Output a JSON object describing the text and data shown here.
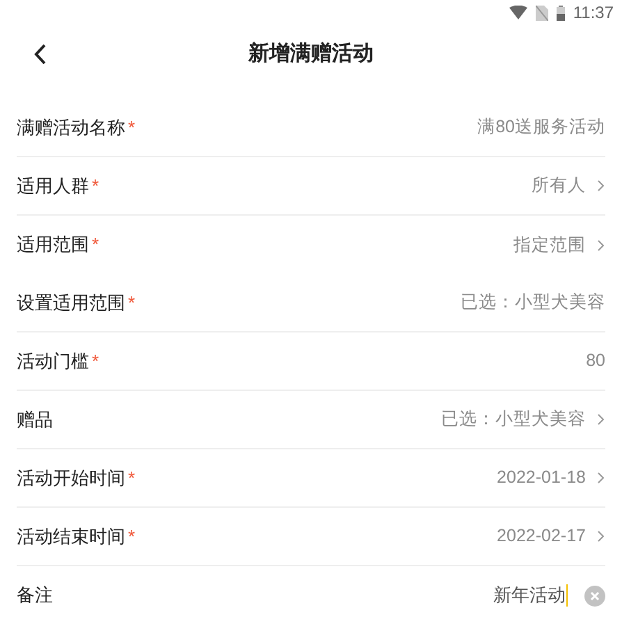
{
  "status_bar": {
    "time": "11:37"
  },
  "header": {
    "title": "新增满赠活动"
  },
  "rows": [
    {
      "kind": "text",
      "label": "满赠活动名称",
      "required_mark": "*",
      "value": "满80送服务活动",
      "divider": true
    },
    {
      "kind": "select",
      "label": "适用人群",
      "required_mark": "*",
      "value": "所有人",
      "divider": true
    },
    {
      "kind": "select",
      "label": "适用范围",
      "required_mark": "*",
      "value": "指定范围",
      "divider": false
    },
    {
      "kind": "text",
      "label": "设置适用范围",
      "required_mark": "*",
      "value": "已选：小型犬美容",
      "divider": true
    },
    {
      "kind": "text",
      "label": "活动门槛",
      "required_mark": "*",
      "value": "80",
      "divider": true
    },
    {
      "kind": "select",
      "label": "赠品",
      "value": "已选：小型犬美容",
      "divider": true
    },
    {
      "kind": "select",
      "label": "活动开始时间",
      "required_mark": "*",
      "value": "2022-01-18",
      "divider": true
    },
    {
      "kind": "select",
      "label": "活动结束时间",
      "required_mark": "*",
      "value": "2022-02-17",
      "divider": true
    },
    {
      "kind": "input",
      "label": "备注",
      "value": "新年活动",
      "divider": false
    }
  ]
}
